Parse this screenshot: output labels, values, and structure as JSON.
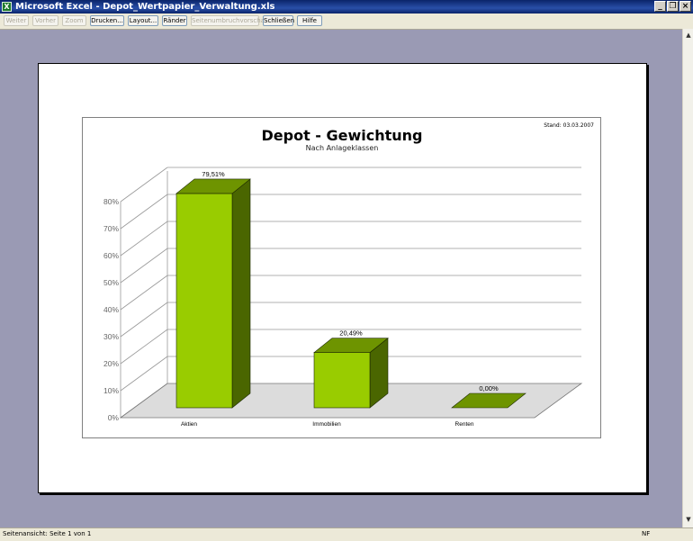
{
  "window": {
    "title": "Microsoft Excel - Depot_Wertpapier_Verwaltung.xls",
    "app_icon": "excel-icon",
    "controls": [
      "minimize-icon",
      "restore-icon",
      "close-icon"
    ]
  },
  "toolbar": {
    "buttons": [
      {
        "label": "Weiter",
        "enabled": false
      },
      {
        "label": "Vorher",
        "enabled": false
      },
      {
        "label": "Zoom",
        "enabled": false
      },
      {
        "label": "Drucken...",
        "enabled": true
      },
      {
        "label": "Layout...",
        "enabled": true
      },
      {
        "label": "Ränder",
        "enabled": true
      },
      {
        "label": "Seitenumbruchvorschau",
        "enabled": false
      },
      {
        "label": "Schließen",
        "enabled": true
      },
      {
        "label": "Hilfe",
        "enabled": true
      }
    ]
  },
  "chart_data": {
    "type": "bar",
    "title": "Depot - Gewichtung",
    "subtitle": "Nach Anlageklassen",
    "date_note": "Stand: 03.03.2007",
    "categories": [
      "Aktien",
      "Immobilien",
      "Renten"
    ],
    "values": [
      79.51,
      20.49,
      0.0
    ],
    "data_labels": [
      "79,51%",
      "20,49%",
      "0,00%"
    ],
    "ylim": [
      0,
      80
    ],
    "yticks": [
      "0%",
      "10%",
      "20%",
      "30%",
      "40%",
      "50%",
      "60%",
      "70%",
      "80%"
    ],
    "bar_style": "3d",
    "grid": true,
    "colors": {
      "front": "#99cc00",
      "top": "#6e9400",
      "side": "#4a6600"
    }
  },
  "statusbar": {
    "left": "Seitenansicht: Seite 1 von 1",
    "right": "NF"
  }
}
